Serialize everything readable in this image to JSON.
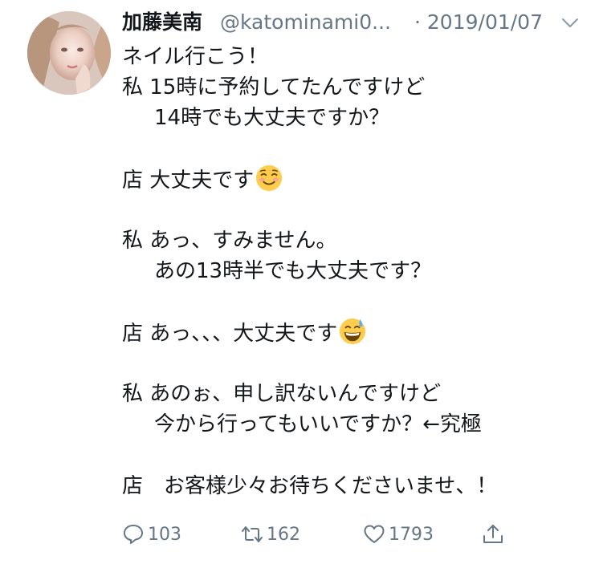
{
  "tweet": {
    "author": {
      "display_name": "加藤美南",
      "handle": "@katominami0...",
      "avatar_icon": "profile-photo"
    },
    "date": "· 2019/01/07",
    "menu_icon": "chevron-down-icon",
    "lines": [
      {
        "text": "ネイル行こう！",
        "indent": false
      },
      {
        "text": "私 15時に予約してたんですけど",
        "indent": false
      },
      {
        "text": "14時でも大丈夫ですか？",
        "indent": true
      },
      {
        "text": "",
        "indent": false
      },
      {
        "text": "店 大丈夫です",
        "indent": false,
        "emoji": "smiling-face-icon"
      },
      {
        "text": "",
        "indent": false
      },
      {
        "text": "私 あっ、すみません。",
        "indent": false
      },
      {
        "text": "あの13時半でも大丈夫です？",
        "indent": true
      },
      {
        "text": "",
        "indent": false
      },
      {
        "text": "店 あっ、、、大丈夫です",
        "indent": false,
        "emoji": "grinning-sweat-face-icon"
      },
      {
        "text": "",
        "indent": false
      },
      {
        "text": "私 あのぉ、申し訳ないんですけど",
        "indent": false
      },
      {
        "text": "今から行ってもいいですか？←究極",
        "indent": true
      },
      {
        "text": "",
        "indent": false
      },
      {
        "text": "店　お客様少々お待ちくださいませ、！",
        "indent": false
      }
    ],
    "actions": {
      "reply_count": "103",
      "retweet_count": "162",
      "like_count": "1793"
    },
    "colors": {
      "text": "#14171a",
      "secondary": "#657786",
      "background": "#ffffff"
    }
  }
}
